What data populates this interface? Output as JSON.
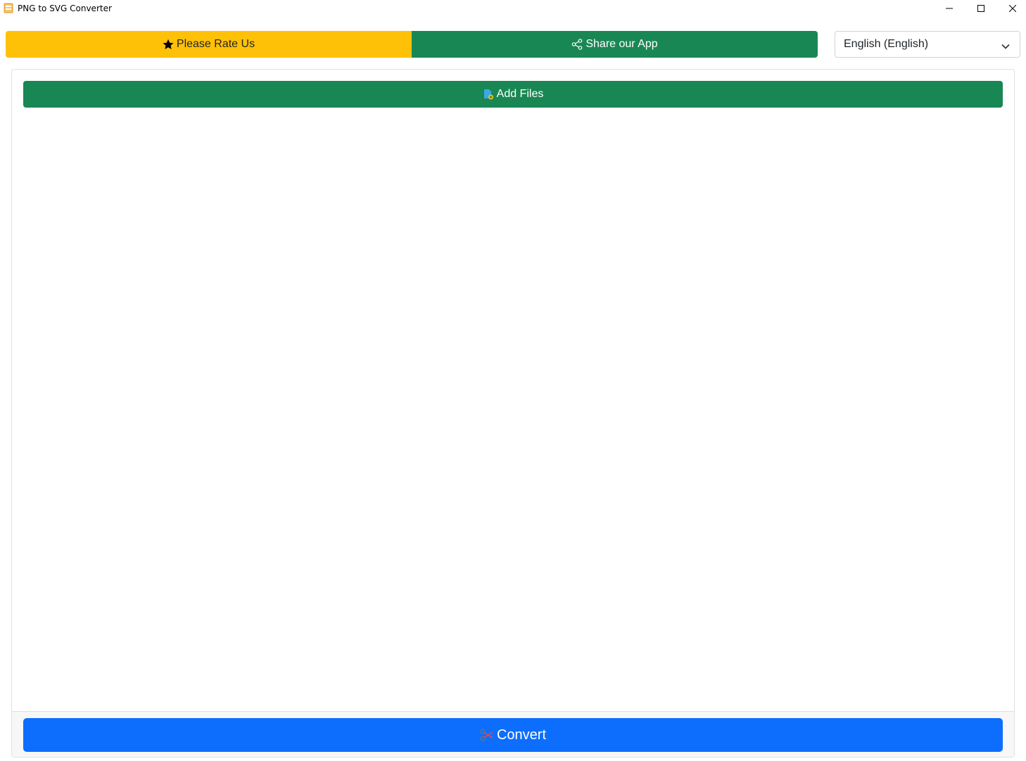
{
  "window": {
    "title": "PNG to SVG Converter",
    "icon": "app-file-icon",
    "controls": [
      "minimize-icon",
      "maximize-icon",
      "close-icon"
    ]
  },
  "toolbar": {
    "rate_label": "Please Rate Us",
    "rate_icon": "star-icon",
    "rate_color": "#ffc107",
    "share_label": "Share our App",
    "share_icon": "share-icon",
    "share_color": "#198754"
  },
  "language": {
    "selected": "English (English)",
    "icon": "chevron-down-icon"
  },
  "main": {
    "add_files_label": "Add Files",
    "add_files_icon": "add-file-icon",
    "add_files_color": "#198754",
    "convert_label": "Convert",
    "convert_icon": "convert-scissors-icon",
    "convert_color": "#0d6efd"
  }
}
